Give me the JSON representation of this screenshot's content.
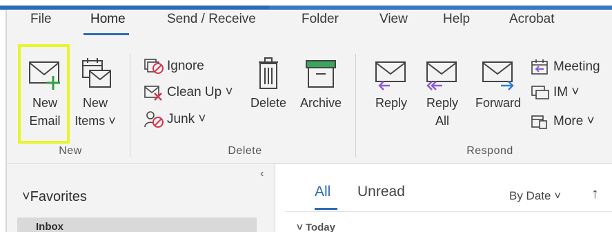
{
  "tabs": [
    {
      "label": "File"
    },
    {
      "label": "Home"
    },
    {
      "label": "Send / Receive"
    },
    {
      "label": "Folder"
    },
    {
      "label": "View"
    },
    {
      "label": "Help"
    },
    {
      "label": "Acrobat"
    }
  ],
  "ribbon": {
    "new_group": {
      "label": "New",
      "new_email_line1": "New",
      "new_email_line2": "Email",
      "new_items_line1": "New",
      "new_items_line2": "Items ˅"
    },
    "delete_group": {
      "label": "Delete",
      "ignore": "Ignore",
      "clean_up": "Clean Up ˅",
      "junk": "Junk ˅",
      "delete": "Delete",
      "archive": "Archive"
    },
    "respond_group": {
      "label": "Respond",
      "reply": "Reply",
      "reply_all_line1": "Reply",
      "reply_all_line2": "All",
      "forward": "Forward",
      "meeting": "Meeting",
      "im": "IM ˅",
      "more": "More ˅"
    }
  },
  "nav": {
    "collapse": "‹",
    "favorites": "˅Favorites",
    "inbox": "Inbox"
  },
  "list": {
    "filter_all": "All",
    "filter_unread": "Unread",
    "sort": "By Date ˅",
    "sort_direction": "↑",
    "group_today": "˅ Today"
  },
  "colors": {
    "accent": "#2b6bb7",
    "highlight": "#e8f52a",
    "plus": "#2ea043",
    "purple": "#8a5bd6"
  }
}
